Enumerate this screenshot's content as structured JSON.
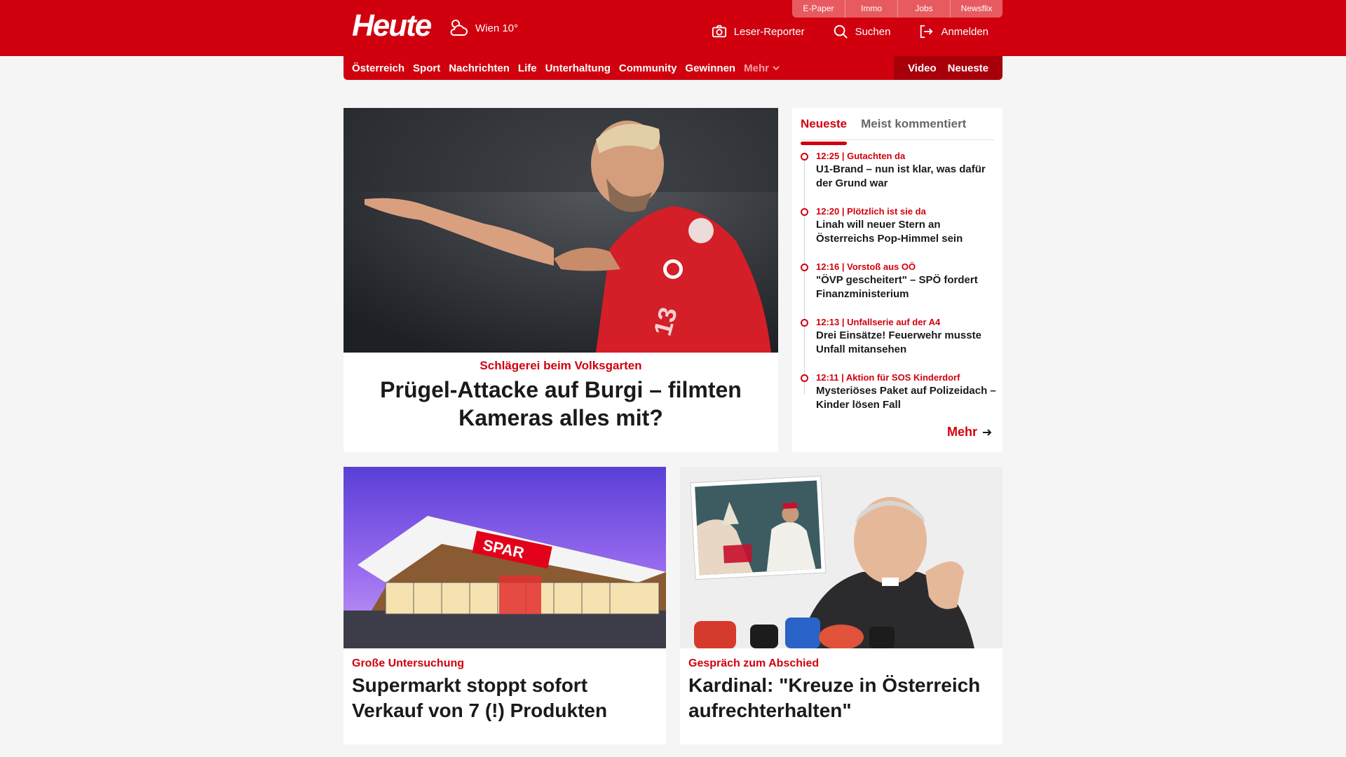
{
  "header": {
    "logo": "Heute",
    "weather": "Wien 10°",
    "services": [
      "E-Paper",
      "Immo",
      "Jobs",
      "Newsflix"
    ],
    "actions": {
      "reporter": "Leser-Reporter",
      "search": "Suchen",
      "login": "Anmelden"
    }
  },
  "nav": {
    "items": [
      "Österreich",
      "Sport",
      "Nachrichten",
      "Life",
      "Unterhaltung",
      "Community",
      "Gewinnen"
    ],
    "more": "Mehr",
    "video": "Video",
    "latest": "Neueste"
  },
  "lead": {
    "kicker": "Schlägerei beim Volksgarten",
    "title": "Prügel-Attacke auf Burgi – filmten Kameras alles mit?"
  },
  "sidebar": {
    "tabs": [
      "Neueste",
      "Meist kommentiert"
    ],
    "items": [
      {
        "meta": "12:25 | Gutachten  da",
        "title": "U1-Brand – nun ist klar, was dafür der Grund war"
      },
      {
        "meta": "12:20 | Plötzlich ist sie da",
        "title": "Linah will neuer Stern an Österreichs Pop-Himmel sein"
      },
      {
        "meta": "12:16 | Vorstoß aus OÖ",
        "title": "\"ÖVP gescheitert\" – SPÖ fordert Finanzministerium"
      },
      {
        "meta": "12:13 | Unfallserie auf der A4",
        "title": "Drei Einsätze! Feuerwehr musste Unfall mitansehen"
      },
      {
        "meta": "12:11 | Aktion für SOS Kinderdorf",
        "title": "Mysteriöses Paket auf Polizeidach – Kinder lösen Fall"
      }
    ],
    "more": "Mehr"
  },
  "cards": [
    {
      "kicker": "Große Untersuchung",
      "title": "Supermarkt stoppt sofort Verkauf von 7 (!) Produkten",
      "sign": "SPAR"
    },
    {
      "kicker": "Gespräch zum Abschied",
      "title": "Kardinal: \"Kreuze in Österreich aufrechterhalten\""
    }
  ]
}
